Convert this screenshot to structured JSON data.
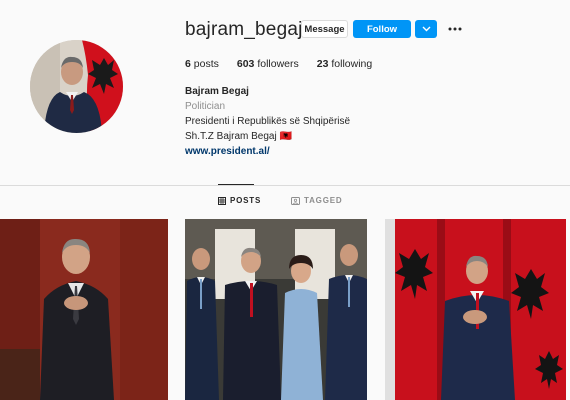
{
  "profile": {
    "username": "bajram_begaj",
    "message_label": "Message",
    "follow_label": "Follow",
    "more_icon": "ellipsis-icon",
    "dropdown_icon": "chevron-down-icon"
  },
  "stats": {
    "posts_count": "6",
    "posts_label": "posts",
    "followers_count": "603",
    "followers_label": "followers",
    "following_count": "23",
    "following_label": "following"
  },
  "bio": {
    "name": "Bajram Begaj",
    "category": "Politician",
    "line1": "Presidenti i Republikës së Shqipërisë",
    "line2": "Sh.T.Z Bajram Begaj 🇦🇱",
    "link": "www.president.al/"
  },
  "tabs": {
    "posts_label": "POSTS",
    "tagged_label": "TAGGED"
  },
  "colors": {
    "follow_blue": "#0095f6",
    "link_navy": "#00376b",
    "flag_red": "#d0101c"
  }
}
